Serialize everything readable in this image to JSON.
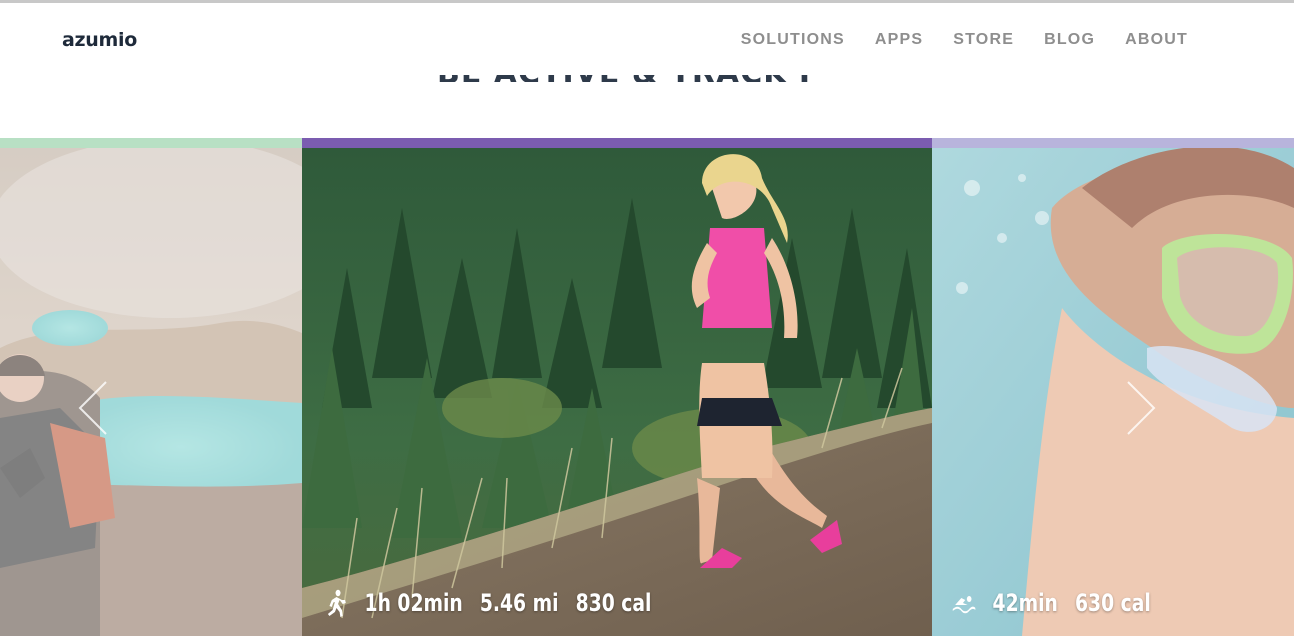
{
  "header": {
    "logo": "azumio",
    "nav": [
      "SOLUTIONS",
      "APPS",
      "STORE",
      "BLOG",
      "ABOUT"
    ]
  },
  "hero": {
    "title": "BE ACTIVE & TRACK IT"
  },
  "slides": [
    {
      "activity": "hiking",
      "bar_color": "#b8e0c4",
      "stats": []
    },
    {
      "activity": "running",
      "bar_color": "#7b5cb0",
      "stats": [
        "1h 02min",
        "5.46 mi",
        "830 cal"
      ]
    },
    {
      "activity": "swimming",
      "bar_color": "#b8b4dc",
      "stats": [
        "42min",
        "630 cal"
      ]
    }
  ],
  "icons": {
    "run": "running-person-icon",
    "swim": "swimmer-icon",
    "prev": "chevron-left-icon",
    "next": "chevron-right-icon"
  }
}
